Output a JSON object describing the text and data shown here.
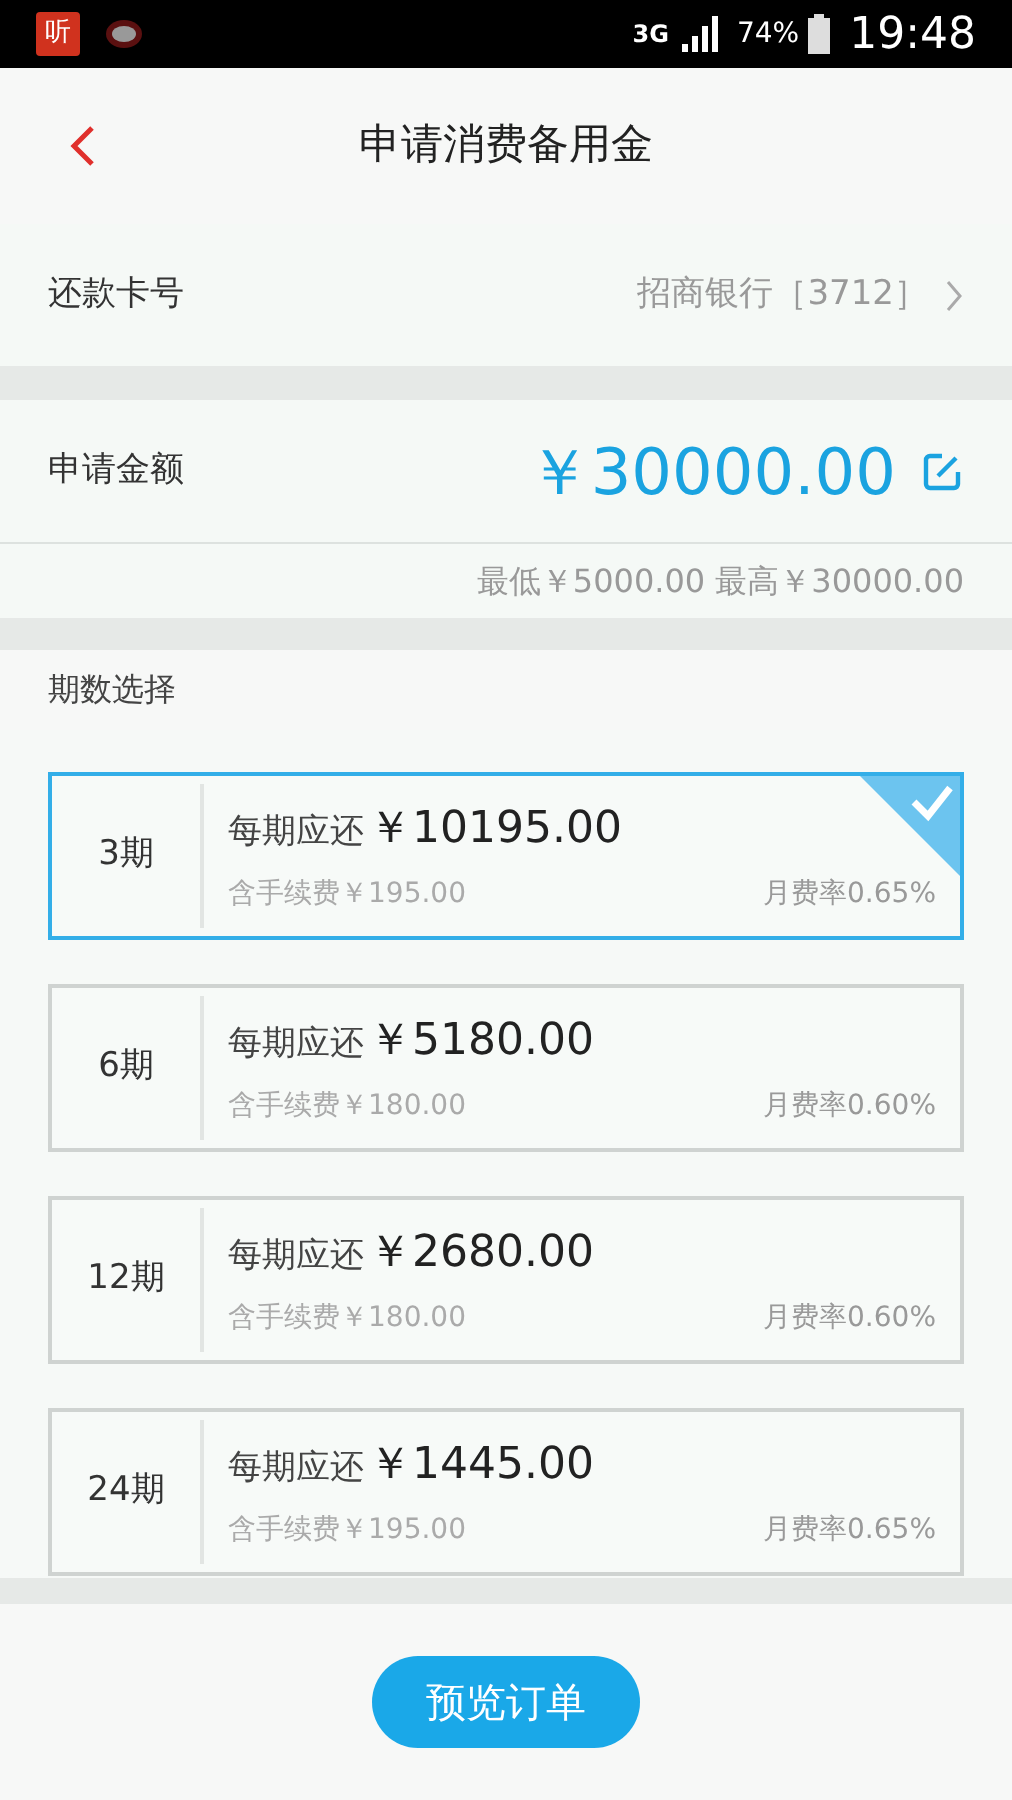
{
  "status_bar": {
    "app_label": "听",
    "network": "3G",
    "battery": "74%",
    "time": "19:48"
  },
  "header": {
    "title": "申请消费备用金"
  },
  "card_row": {
    "label": "还款卡号",
    "value": "招商银行［3712］"
  },
  "amount": {
    "label": "申请金额",
    "value": "￥30000.00",
    "limits": "最低￥5000.00 最高￥30000.00"
  },
  "term_section": {
    "label": "期数选择"
  },
  "terms": [
    {
      "term": "3期",
      "payment_label": "每期应还",
      "payment": "￥10195.00",
      "fee": "含手续费￥195.00",
      "rate": "月费率0.65%",
      "selected": true
    },
    {
      "term": "6期",
      "payment_label": "每期应还",
      "payment": "￥5180.00",
      "fee": "含手续费￥180.00",
      "rate": "月费率0.60%",
      "selected": false
    },
    {
      "term": "12期",
      "payment_label": "每期应还",
      "payment": "￥2680.00",
      "fee": "含手续费￥180.00",
      "rate": "月费率0.60%",
      "selected": false
    },
    {
      "term": "24期",
      "payment_label": "每期应还",
      "payment": "￥1445.00",
      "fee": "含手续费￥195.00",
      "rate": "月费率0.65%",
      "selected": false
    }
  ],
  "button": {
    "label": "预览订单"
  }
}
